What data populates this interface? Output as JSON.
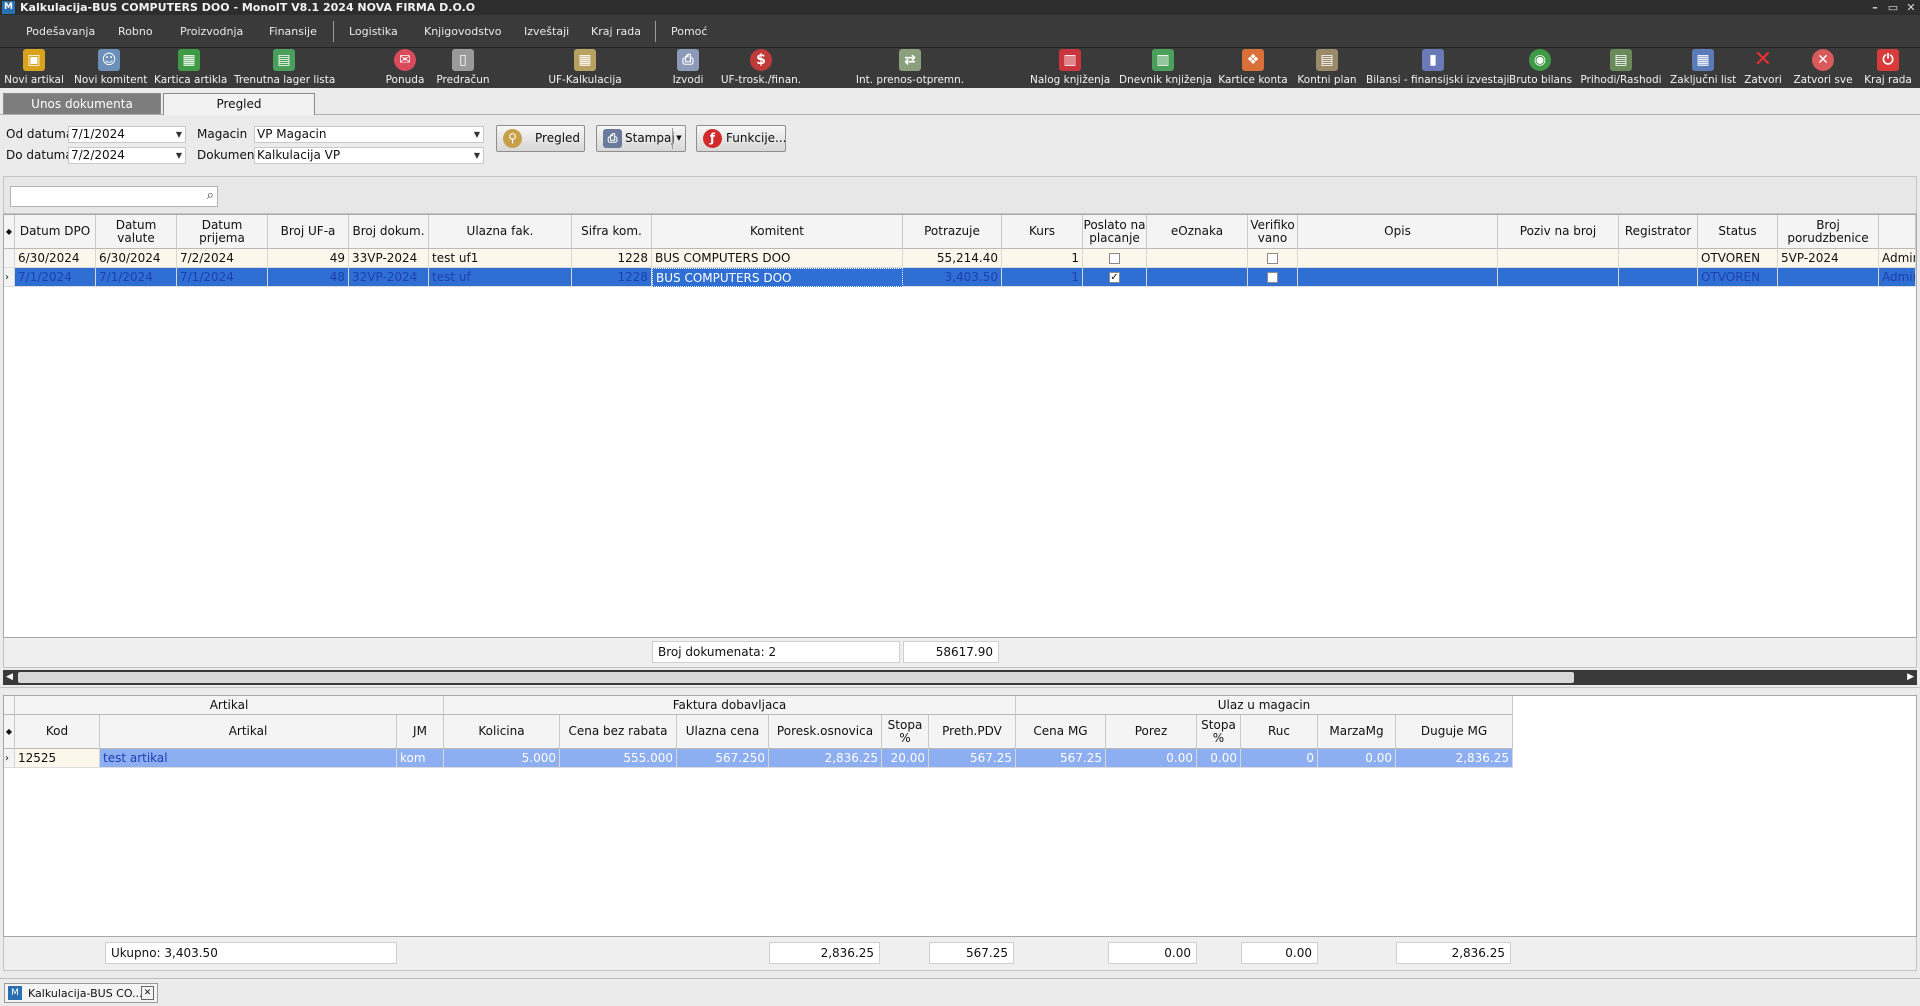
{
  "window": {
    "title": "Kalkulacija-BUS COMPUTERS DOO - MonoIT V8.1 2024 NOVA FIRMA D.O.O",
    "controls": [
      "–",
      "▭",
      "✕"
    ]
  },
  "menu": [
    "Podešavanja",
    "Robno",
    "Proizvodnja",
    "Finansije",
    "Logistika",
    "Knjigovodstvo",
    "Izveštaji",
    "Kraj rada",
    "Pomoć"
  ],
  "toolbar": [
    {
      "label": "Novi artikal",
      "icon": "box-icon",
      "color": "#d9a21b"
    },
    {
      "label": "Novi komitent",
      "icon": "person-icon",
      "color": "#6b8fb8"
    },
    {
      "label": "Kartica artikla",
      "icon": "calendar-icon",
      "color": "#3e9a45"
    },
    {
      "label": "Trenutna lager lista",
      "icon": "sheet-icon",
      "color": "#4a9f5a"
    },
    {
      "label": "Ponuda",
      "icon": "offer-icon",
      "color": "#d94a5a"
    },
    {
      "label": "Predračun",
      "icon": "document-icon",
      "color": "#9a9a9a"
    },
    {
      "label": "UF-Kalkulacija",
      "icon": "table-icon",
      "color": "#b8a060"
    },
    {
      "label": "Izvodi",
      "icon": "printer-icon",
      "color": "#8a9ab8"
    },
    {
      "label": "UF-trosk./finan.",
      "icon": "money-icon",
      "color": "#c03a3a"
    },
    {
      "label": "Int. prenos-otpremn.",
      "icon": "transfer-icon",
      "color": "#8aa07a"
    },
    {
      "label": "Nalog knjiženja",
      "icon": "book-icon",
      "color": "#c9343e"
    },
    {
      "label": "Dnevnik knjiženja",
      "icon": "journal-icon",
      "color": "#4a9f5a"
    },
    {
      "label": "Kartice konta",
      "icon": "cards-icon",
      "color": "#d9703a"
    },
    {
      "label": "Kontni plan",
      "icon": "plan-icon",
      "color": "#9a8a6a"
    },
    {
      "label": "Bilansi - finansijski izvestaji",
      "icon": "chart-icon",
      "color": "#6a7ab8"
    },
    {
      "label": "Bruto bilans",
      "icon": "globe-icon",
      "color": "#3e9a45"
    },
    {
      "label": "Prihodi/Rashodi",
      "icon": "income-icon",
      "color": "#6a8a5a"
    },
    {
      "label": "Zaključni list",
      "icon": "list-icon",
      "color": "#5a7ab8"
    },
    {
      "label": "Zatvori",
      "icon": "close-icon",
      "color": "#d93a3a"
    },
    {
      "label": "Zatvori sve",
      "icon": "close-all-icon",
      "color": "#d95a5a"
    },
    {
      "label": "Kraj rada",
      "icon": "power-icon",
      "color": "#d93a3a"
    }
  ],
  "tabs": {
    "entry": "Unos dokumenta",
    "review": "Pregled"
  },
  "filters": {
    "od_label": "Od datuma",
    "od_value": "7/1/2024",
    "do_label": "Do datuma",
    "do_value": "7/2/2024",
    "magacin_label": "Magacin",
    "magacin_value": "VP Magacin",
    "dokument_label": "Dokument",
    "dokument_value": "Kalkulacija VP"
  },
  "buttons": {
    "pregled": "Pregled",
    "stampaj": "Stampaj",
    "funkcije": "Funkcije..."
  },
  "search": {
    "placeholder": ""
  },
  "main_grid": {
    "headers": [
      "Datum DPO",
      "Datum valute",
      "Datum prijema",
      "Broj UF-a",
      "Broj dokum.",
      "Ulazna fak.",
      "Sifra kom.",
      "Komitent",
      "Potrazuje",
      "Kurs",
      "Poslato na placanje",
      "eOznaka",
      "Verifiko vano",
      "Opis",
      "Poziv na broj",
      "Registrator",
      "Status",
      "Broj porudzbenice",
      ""
    ],
    "rows": [
      [
        "6/30/2024",
        "6/30/2024",
        "7/2/2024",
        "49",
        "33VP-2024",
        "test uf1",
        "1228",
        "BUS COMPUTERS DOO",
        "55,214.40",
        "1",
        "",
        "",
        "",
        "",
        "",
        "",
        "OTVOREN",
        "5VP-2024",
        "Admin"
      ],
      [
        "7/1/2024",
        "7/1/2024",
        "7/1/2024",
        "48",
        "32VP-2024",
        "test uf",
        "1228",
        "BUS COMPUTERS DOO",
        "3,403.50",
        "1",
        "✓",
        "",
        "",
        "",
        "",
        "",
        "OTVOREN",
        "",
        "Admin"
      ]
    ],
    "footer_count": "Broj dokumenata: 2",
    "footer_sum": "58617.90"
  },
  "detail_grid": {
    "groups": [
      "Artikal",
      "Faktura dobavljaca",
      "Ulaz u magacin"
    ],
    "headers": [
      "Kod",
      "Artikal",
      "JM",
      "Kolicina",
      "Cena bez rabata",
      "Ulazna cena",
      "Poresk.osnovica",
      "Stopa %",
      "Preth.PDV",
      "Cena MG",
      "Porez",
      "Stopa %",
      "Ruc",
      "MarzaMg",
      "Duguje MG"
    ],
    "rows": [
      [
        "12525",
        "test artikal",
        "kom",
        "5.000",
        "555.000",
        "567.250",
        "2,836.25",
        "20.00",
        "567.25",
        "567.25",
        "0.00",
        "0.00",
        "0",
        "0.00",
        "2,836.25"
      ]
    ],
    "totals": {
      "ukupno": "Ukupno:  3,403.50",
      "poresk": "2,836.25",
      "pdv": "567.25",
      "porez": "0.00",
      "ruc": "0.00",
      "duguje": "2,836.25"
    }
  },
  "statusbar": {
    "doc_tab": "Kalkulacija-BUS CO..."
  }
}
